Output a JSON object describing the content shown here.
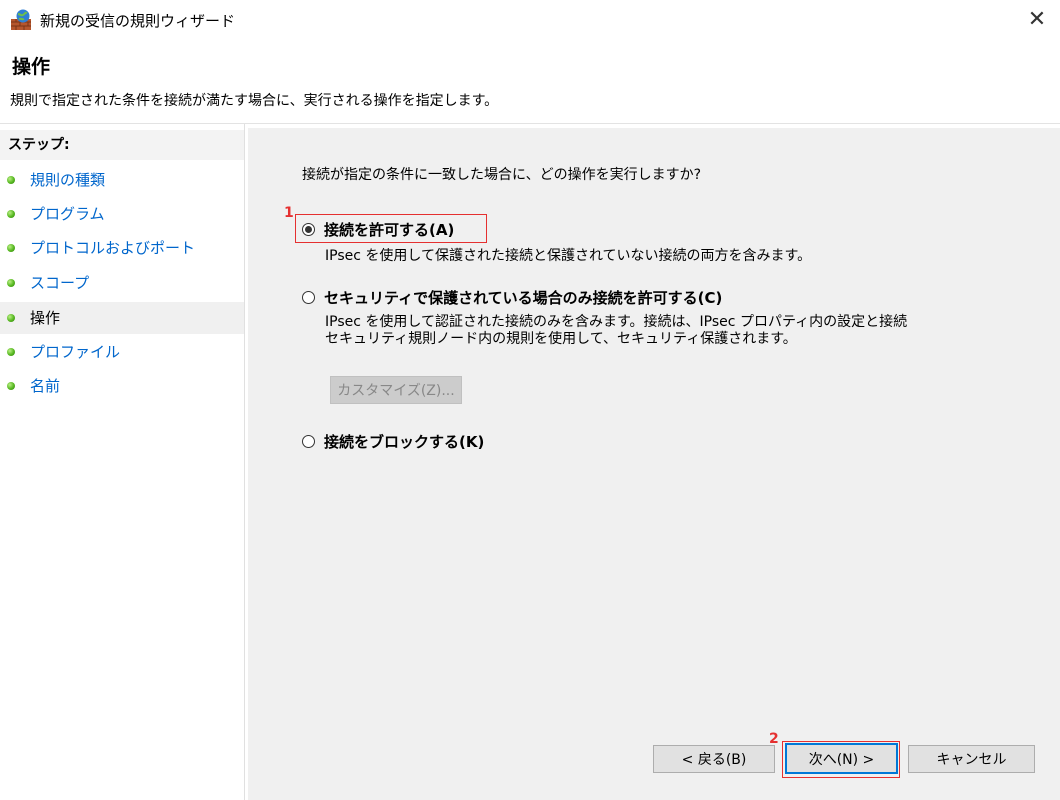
{
  "window": {
    "title": "新規の受信の規則ウィザード",
    "close_glyph": "✕"
  },
  "header": {
    "title": "操作",
    "description": "規則で指定された条件を接続が満たす場合に、実行される操作を指定します。"
  },
  "steps": {
    "label": "ステップ:",
    "items": [
      {
        "label": "規則の種類"
      },
      {
        "label": "プログラム"
      },
      {
        "label": "プロトコルおよびポート"
      },
      {
        "label": "スコープ"
      },
      {
        "label": "操作"
      },
      {
        "label": "プロファイル"
      },
      {
        "label": "名前"
      }
    ],
    "current": "操作"
  },
  "main": {
    "question": "接続が指定の条件に一致した場合に、どの操作を実行しますか?",
    "options": [
      {
        "label": "接続を許可する(A)",
        "description": "IPsec を使用して保護された接続と保護されていない接続の両方を含みます。",
        "checked": true
      },
      {
        "label": "セキュリティで保護されている場合のみ接続を許可する(C)",
        "description_lines": [
          "IPsec を使用して認証された接続のみを含みます。接続は、IPsec プロパティ内の設定と接続",
          "セキュリティ規則ノード内の規則を使用して、セキュリティ保護されます。"
        ],
        "checked": false
      },
      {
        "label": "接続をブロックする(K)",
        "checked": false
      }
    ],
    "customize_button": "カスタマイズ(Z)..."
  },
  "footer": {
    "back_button": "< 戻る(B)",
    "next_button": "次へ(N) >",
    "cancel_button": "キャンセル"
  },
  "annotations": {
    "marker_1": "1",
    "marker_2": "2",
    "color": "#e53030"
  }
}
